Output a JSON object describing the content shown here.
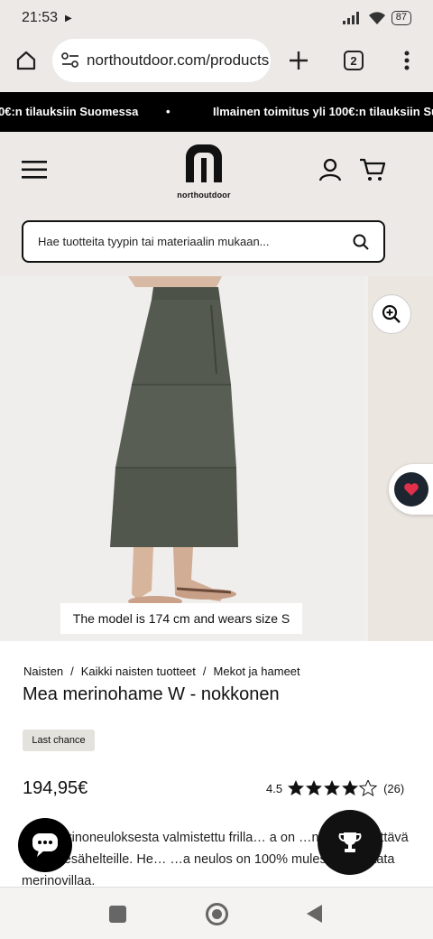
{
  "status_bar": {
    "time": "21:53",
    "battery": "87"
  },
  "browser": {
    "url": "northoutdoor.com/products",
    "tab_count": "2"
  },
  "announcement": {
    "text_left": "0€:n tilauksiin Suomessa",
    "separator": "•",
    "text_right": "Ilmainen toimitus yli 100€:n tilauksiin Suom"
  },
  "header": {
    "logo_text": "northoutdoor",
    "search_placeholder": "Hae tuotteita tyypin tai materiaalin mukaan..."
  },
  "gallery": {
    "model_caption": "The model is 174 cm and wears size S"
  },
  "product": {
    "breadcrumb": [
      "Naisten",
      "Kaikki naisten tuotteet",
      "Mekot ja hameet"
    ],
    "breadcrumb_sep": "/",
    "title": "Mea merinohame W - nokkonen",
    "badge": "Last chance",
    "price": "194,95€",
    "rating_value": "4.5",
    "rating_stars": 4.5,
    "review_count": "(26)",
    "description_visible": "…tä merinoneuloksesta valmistettu frilla… a on …n mutta näyttävä vaate kesähelteille. He… …a neulos on 100% mulesing-vapaata merinovillaa."
  },
  "colors": {
    "accent_dark": "#1d2630",
    "wishlist_heart": "#e0304a",
    "skirt": "#545a50",
    "header_bg": "#ece9e6"
  }
}
